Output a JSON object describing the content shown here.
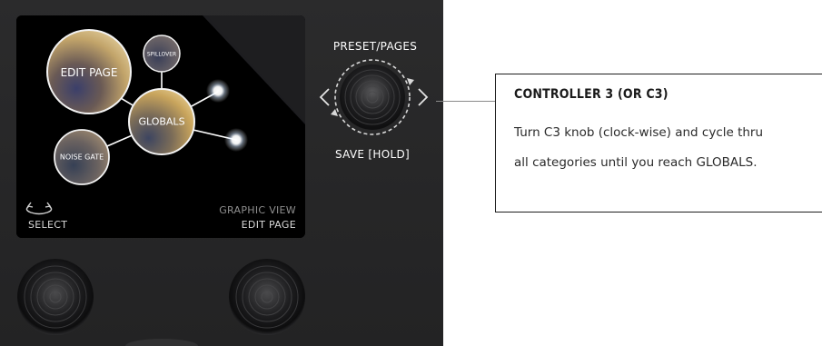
{
  "screen": {
    "bubbles": {
      "edit_page": "EDIT PAGE",
      "spillover": "SPILLOVER",
      "globals": "GLOBALS",
      "noise_gate": "NOISE GATE"
    },
    "select_label": "SELECT",
    "view_label": "GRAPHIC VIEW",
    "page_label": "EDIT PAGE"
  },
  "controller": {
    "top_label": "PRESET/PAGES",
    "bottom_label": "SAVE [HOLD]"
  },
  "callout": {
    "title": "CONTROLLER 3 (OR C3)",
    "line1": "Turn C3 knob (clock-wise) and cycle thru",
    "line2": "all categories until you reach GLOBALS."
  }
}
